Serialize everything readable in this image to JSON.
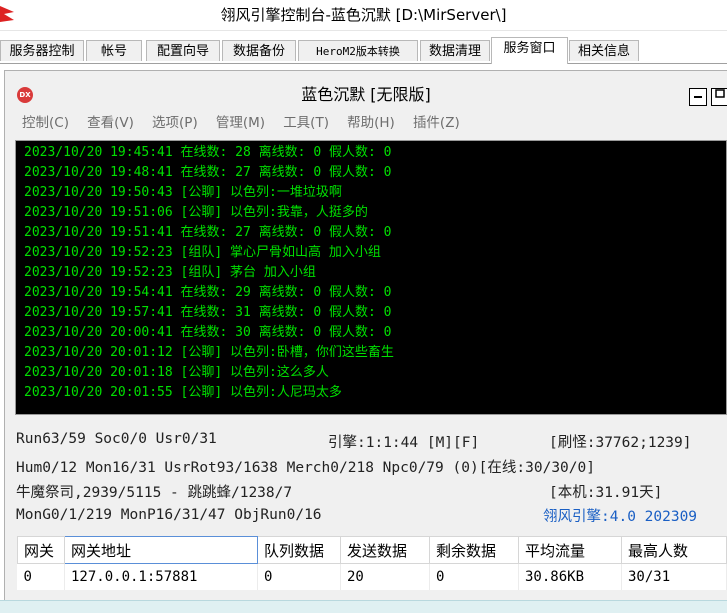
{
  "window": {
    "title": "翎风引擎控制台-蓝色沉默 [D:\\MirServer\\]"
  },
  "tabs": [
    {
      "label": "服务器控制"
    },
    {
      "label": "帐号"
    },
    {
      "label": "配置向导"
    },
    {
      "label": "数据备份"
    },
    {
      "label": "HeroM2版本转换"
    },
    {
      "label": "数据清理"
    },
    {
      "label": "服务窗口"
    },
    {
      "label": "相关信息"
    }
  ],
  "active_tab": "服务窗口",
  "server_window": {
    "title": "蓝色沉默 [无限版]",
    "icon": "dx-logo-icon",
    "menu": [
      {
        "label": "控制(C)"
      },
      {
        "label": "查看(V)"
      },
      {
        "label": "选项(P)"
      },
      {
        "label": "管理(M)"
      },
      {
        "label": "工具(T)"
      },
      {
        "label": "帮助(H)"
      },
      {
        "label": "插件(Z)"
      }
    ],
    "log_lines": [
      "2023/10/20 19:45:41 在线数: 28 离线数: 0 假人数: 0",
      "2023/10/20 19:48:41 在线数: 27 离线数: 0 假人数: 0",
      "2023/10/20 19:50:43 [公聊] 以色列:一堆垃圾啊",
      "2023/10/20 19:51:06 [公聊] 以色列:我靠，人挺多的",
      "2023/10/20 19:51:41 在线数: 27 离线数: 0 假人数: 0",
      "2023/10/20 19:52:23 [组队] 掌心尸骨如山高 加入小组",
      "2023/10/20 19:52:23 [组队] 茅台 加入小组",
      "2023/10/20 19:54:41 在线数: 29 离线数: 0 假人数: 0",
      "2023/10/20 19:57:41 在线数: 31 离线数: 0 假人数: 0",
      "2023/10/20 20:00:41 在线数: 30 离线数: 0 假人数: 0",
      "2023/10/20 20:01:12 [公聊] 以色列:卧槽，你们这些畜生",
      "2023/10/20 20:01:18 [公聊] 以色列:这么多人",
      "2023/10/20 20:01:55 [公聊] 以色列:人尼玛太多"
    ],
    "status": {
      "run": "Run63/59 Soc0/0 Usr0/31",
      "engine": "引擎:1:1:44 [M][F]",
      "monster": "[刷怪:37762;1239]",
      "line2": "Hum0/12 Mon16/31 UsrRot93/1638 Merch0/218 Npc0/79 (0)[在线:30/30/0]",
      "line3": "牛魔祭司,2939/5115 - 跳跳蜂/1238/7",
      "local": "[本机:31.91天]",
      "line4": "MonG0/1/219 MonP16/31/47 ObjRun0/16",
      "version": "翎风引擎:4.0 202309"
    },
    "gateway_table": {
      "columns": [
        "网关",
        "网关地址",
        "队列数据",
        "发送数据",
        "剩余数据",
        "平均流量",
        "最高人数"
      ],
      "rows": [
        [
          "0",
          "127.0.0.1:57881",
          "0",
          "20",
          "0",
          "30.86KB",
          "30/31"
        ]
      ]
    }
  }
}
